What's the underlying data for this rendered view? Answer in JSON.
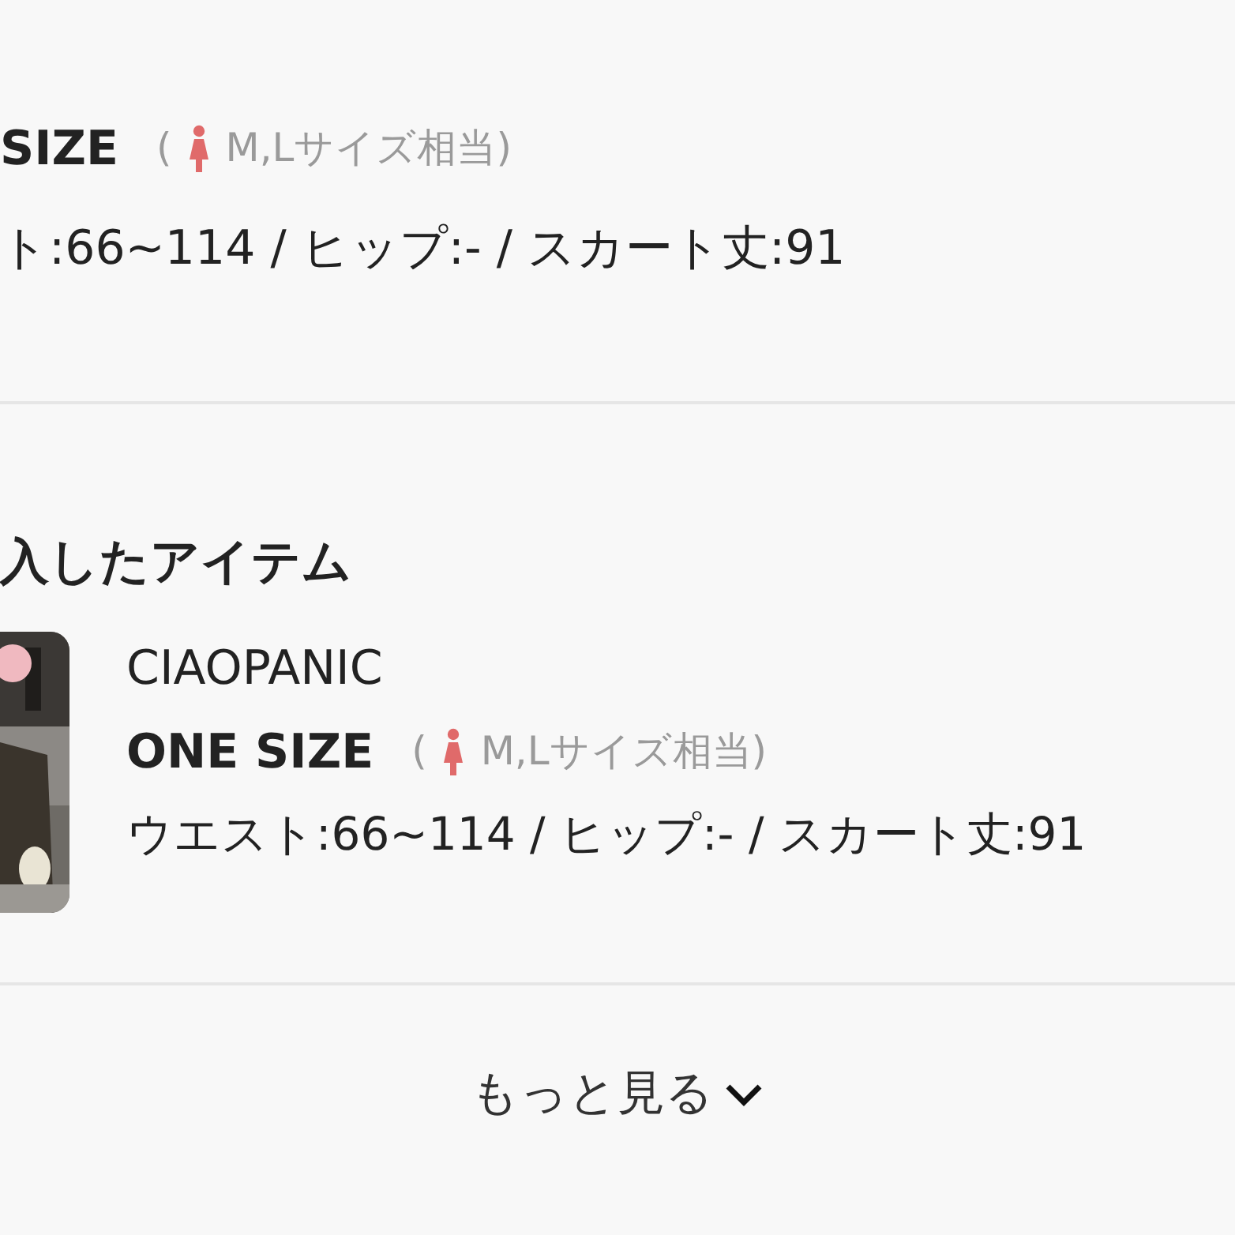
{
  "top_item": {
    "size": "SIZE",
    "paren_open": "(",
    "size_note": "M,Lサイズ相当)",
    "measurements": "ト:66~114 / ヒップ:- / スカート丈:91"
  },
  "purchased": {
    "heading": "入したアイテム",
    "items": [
      {
        "brand": "CIAOPANIC",
        "size": "ONE SIZE",
        "paren_open": "(",
        "size_note": "M,Lサイズ相当)",
        "measurements": "ウエスト:66~114 / ヒップ:- / スカート丈:91"
      }
    ]
  },
  "more_button": {
    "label": "もっと見る"
  }
}
